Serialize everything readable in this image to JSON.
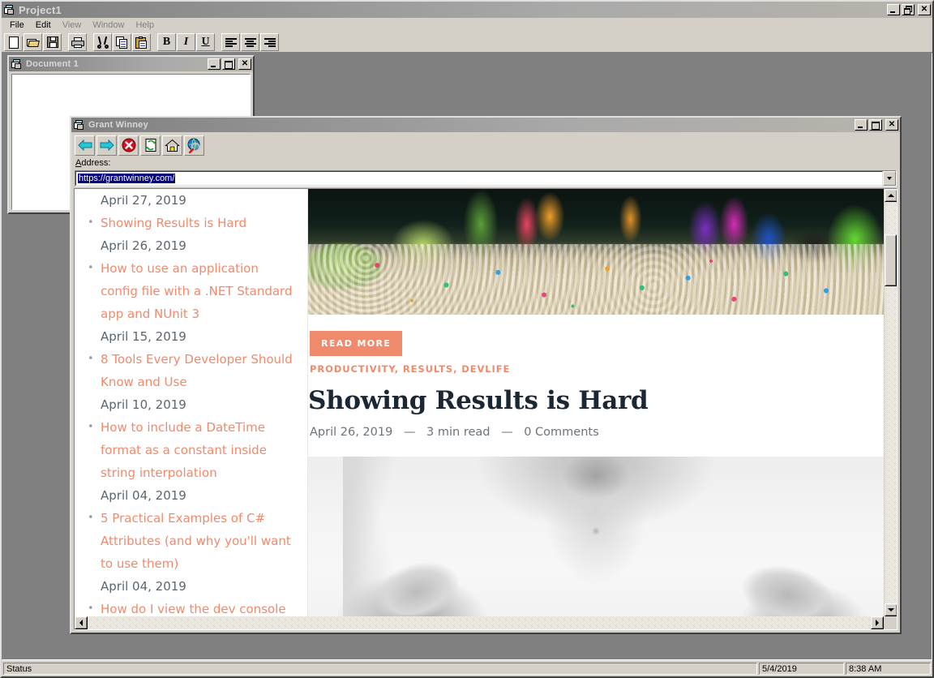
{
  "app": {
    "title": "Project1",
    "icon": "mdi-app-icon",
    "window_buttons": {
      "minimize": "_",
      "restore": "❐",
      "close": "✕"
    },
    "menu": [
      "File",
      "Edit",
      "View",
      "Window",
      "Help"
    ],
    "toolbar": [
      {
        "name": "new-document",
        "label": "New"
      },
      {
        "name": "open-document",
        "label": "Open"
      },
      {
        "name": "save-document",
        "label": "Save"
      },
      {
        "name": "print-document",
        "label": "Print"
      },
      {
        "name": "cut",
        "label": "Cut"
      },
      {
        "name": "copy",
        "label": "Copy"
      },
      {
        "name": "paste",
        "label": "Paste"
      },
      {
        "name": "bold",
        "label": "B"
      },
      {
        "name": "italic",
        "label": "I"
      },
      {
        "name": "underline",
        "label": "U"
      },
      {
        "name": "align-left",
        "label": "Align Left"
      },
      {
        "name": "align-center",
        "label": "Align Center"
      },
      {
        "name": "align-right",
        "label": "Align Right"
      }
    ]
  },
  "document_window": {
    "title": "Document 1",
    "buttons": {
      "minimize": "_",
      "maximize": "□",
      "close": "✕"
    }
  },
  "browser_window": {
    "title": "Grant Winney",
    "buttons": {
      "minimize": "_",
      "maximize": "□",
      "close": "✕"
    },
    "toolbar": [
      {
        "name": "back-icon",
        "label": "Back"
      },
      {
        "name": "forward-icon",
        "label": "Forward"
      },
      {
        "name": "stop-icon",
        "label": "Stop"
      },
      {
        "name": "refresh-icon",
        "label": "Refresh"
      },
      {
        "name": "home-icon",
        "label": "Home"
      },
      {
        "name": "search-icon",
        "label": "Search"
      }
    ],
    "address_label": "Address:",
    "address_value": "https://grantwinney.com/"
  },
  "website": {
    "sidebar": {
      "items": [
        {
          "type": "date",
          "text": "April 27, 2019"
        },
        {
          "type": "link",
          "text": "Showing Results is Hard"
        },
        {
          "type": "date",
          "text": "April 26, 2019"
        },
        {
          "type": "link",
          "text": "How to use an application config file with a .NET Standard app and NUnit 3"
        },
        {
          "type": "date",
          "text": "April 15, 2019"
        },
        {
          "type": "link",
          "text": "8 Tools Every Developer Should Know and Use"
        },
        {
          "type": "date",
          "text": "April 10, 2019"
        },
        {
          "type": "link",
          "text": "How to include a DateTime format as a constant inside string interpolation"
        },
        {
          "type": "date",
          "text": "April 04, 2019"
        },
        {
          "type": "link",
          "text": "5 Practical Examples of C# Attributes (and why you'll want to use them)"
        },
        {
          "type": "date",
          "text": "April 04, 2019"
        },
        {
          "type": "link",
          "text": "How do I view the dev console in my browser?"
        }
      ]
    },
    "main": {
      "hero_image_alt": "aquarium-photo",
      "read_more": "READ MORE",
      "tags": "PRODUCTIVITY, RESULTS, DEVLIFE",
      "post_title": "Showing Results is Hard",
      "post_date": "April 26, 2019",
      "read_time": "3 min read",
      "comments": "0 Comments",
      "meta_separator": "—",
      "second_image_alt": "open-hands-photo"
    },
    "colors": {
      "accent": "#f08a6d",
      "title": "#1b2733",
      "meta": "#6b737c"
    }
  },
  "statusbar": {
    "status": "Status",
    "date": "5/4/2019",
    "time": "8:38 AM"
  }
}
